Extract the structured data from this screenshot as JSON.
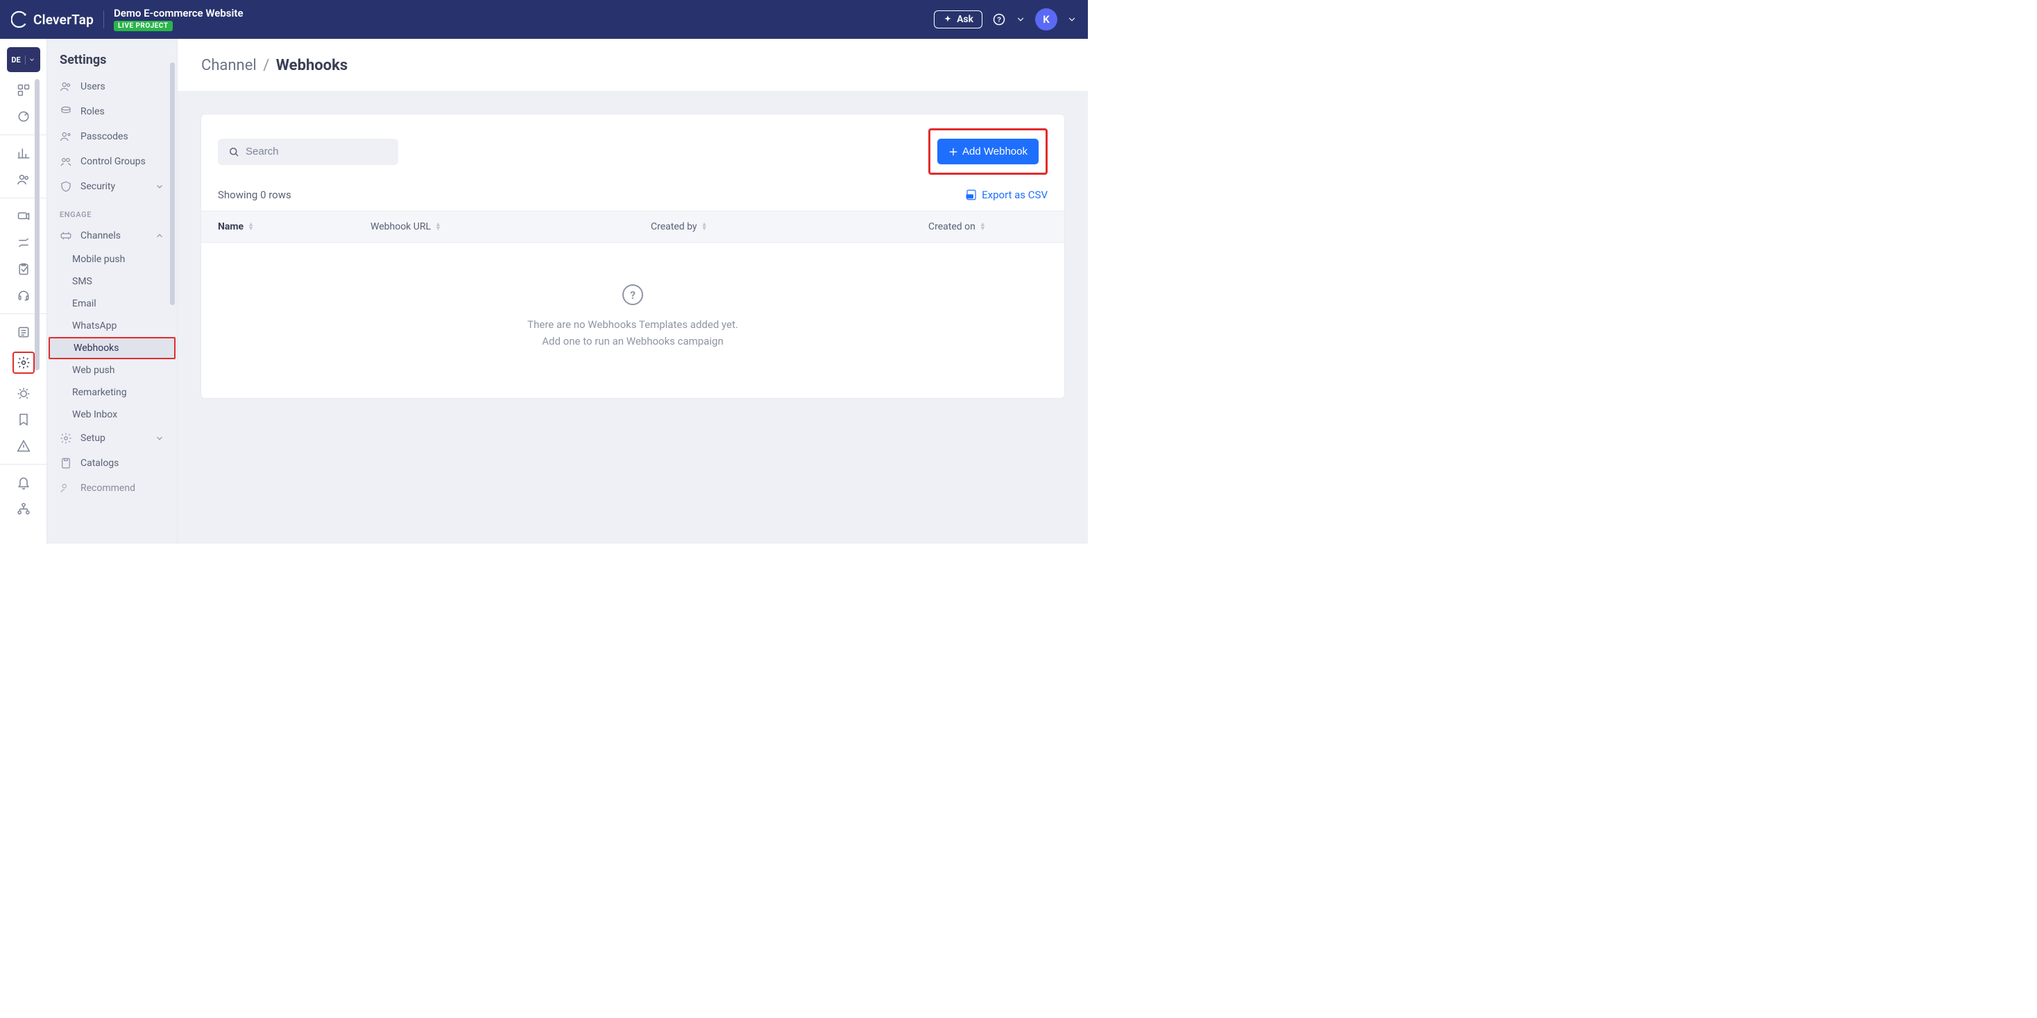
{
  "brand": {
    "name": "CleverTap"
  },
  "project": {
    "title": "Demo E-commerce Website",
    "badge": "LIVE PROJECT",
    "code": "DE"
  },
  "topnav": {
    "ask": "Ask",
    "avatar_initial": "K"
  },
  "sidebar": {
    "title": "Settings",
    "items": {
      "users": "Users",
      "roles": "Roles",
      "passcodes": "Passcodes",
      "control_groups": "Control Groups",
      "security": "Security"
    },
    "section_engage": "ENGAGE",
    "channels_label": "Channels",
    "channels": [
      "Mobile push",
      "SMS",
      "Email",
      "WhatsApp",
      "Webhooks",
      "Web push",
      "Remarketing",
      "Web Inbox"
    ],
    "setup_label": "Setup",
    "catalogs": "Catalogs",
    "recommend": "Recommend"
  },
  "breadcrumb": {
    "parent": "Channel",
    "current": "Webhooks"
  },
  "search": {
    "placeholder": "Search"
  },
  "buttons": {
    "add_webhook": "Add Webhook",
    "export": "Export as CSV"
  },
  "table": {
    "showing": "Showing 0 rows",
    "cols": {
      "name": "Name",
      "url": "Webhook URL",
      "created_by": "Created by",
      "created_on": "Created on"
    },
    "empty1": "There are no Webhooks Templates added yet.",
    "empty2": "Add one to run an Webhooks campaign"
  }
}
